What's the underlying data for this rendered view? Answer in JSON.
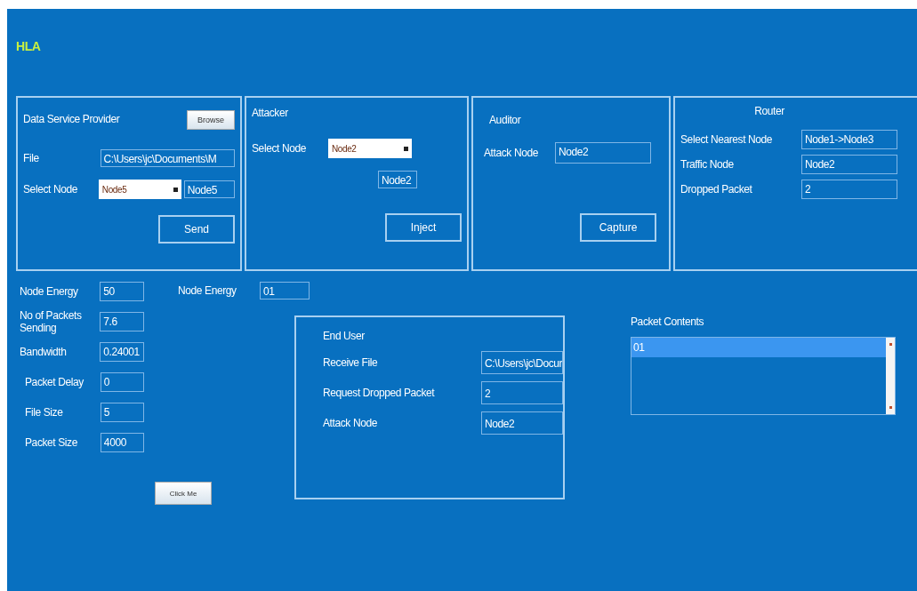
{
  "title": "HLA",
  "provider": {
    "title": "Data Service Provider",
    "browse": "Browse",
    "file": {
      "label": "File",
      "value": "C:\\Users\\jc\\Documents\\M"
    },
    "select": {
      "label": "Select Node",
      "value": "Node5"
    },
    "node": "Node5",
    "button": "Send"
  },
  "attacker": {
    "title": "Attacker",
    "select": {
      "label": "Select Node",
      "value": "Node2"
    },
    "node": "Node2",
    "button": "Inject"
  },
  "auditor": {
    "title": "Auditor",
    "field": {
      "label": "Attack Node",
      "value": "Node2"
    },
    "button": "Capture"
  },
  "router": {
    "title": "Router",
    "fields": [
      {
        "label": "Select Nearest Node",
        "value": "Node1->Node3"
      },
      {
        "label": "Traffic Node",
        "value": "Node2"
      },
      {
        "label": "Dropped Packet",
        "value": "2"
      }
    ]
  },
  "stats": [
    {
      "label": "Node Energy",
      "value": "50"
    },
    {
      "label": "No of Packets Sending",
      "value": "7.6"
    },
    {
      "label": "Bandwidth",
      "value": "0.24001"
    },
    {
      "label": "Packet Delay",
      "value": "0"
    },
    {
      "label": "File Size",
      "value": "5"
    },
    {
      "label": "Packet Size",
      "value": "4000"
    }
  ],
  "click_button": "Click Me",
  "node_energy": {
    "label": "Node Energy",
    "value": "01"
  },
  "end_user": {
    "title": "End User",
    "fields": [
      {
        "label": "Receive File",
        "value": "C:\\Users\\jc\\Docur"
      },
      {
        "label": "Request Dropped Packet",
        "value": "2"
      },
      {
        "label": "Attack Node",
        "value": "Node2"
      }
    ]
  },
  "packet_contents": {
    "label": "Packet Contents",
    "items": [
      {
        "text": "01",
        "selected": true
      }
    ]
  }
}
